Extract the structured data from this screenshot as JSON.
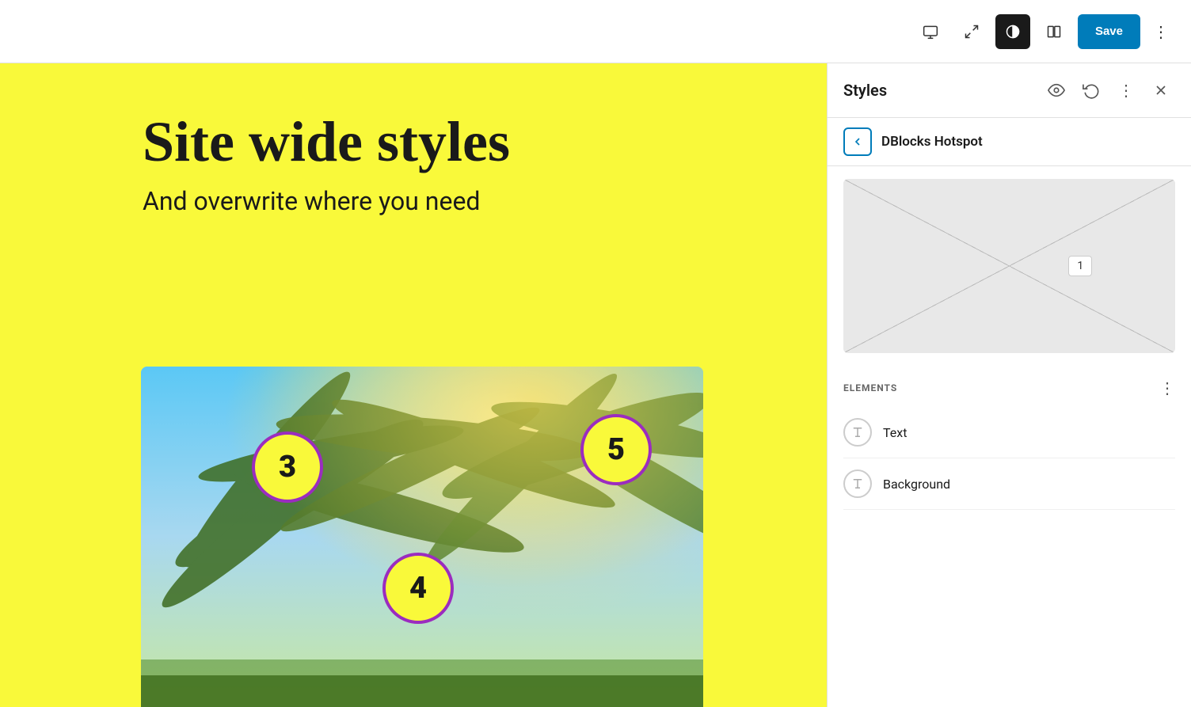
{
  "toolbar": {
    "save_label": "Save",
    "device_desktop_title": "Desktop view",
    "device_fullscreen_title": "Fullscreen view",
    "contrast_title": "Contrast mode",
    "split_title": "Split view",
    "more_title": "More options"
  },
  "canvas": {
    "main_heading": "Site wide styles",
    "sub_heading": "And overwrite where you need",
    "hotspots": [
      {
        "id": "hotspot-3",
        "label": "3"
      },
      {
        "id": "hotspot-4",
        "label": "4"
      },
      {
        "id": "hotspot-5",
        "label": "5"
      }
    ]
  },
  "styles_panel": {
    "title": "Styles",
    "back_label": "DBlocks Hotspot",
    "preview_badge": "1",
    "elements_section_title": "ELEMENTS",
    "elements": [
      {
        "id": "text",
        "label": "Text"
      },
      {
        "id": "background",
        "label": "Background"
      }
    ]
  }
}
